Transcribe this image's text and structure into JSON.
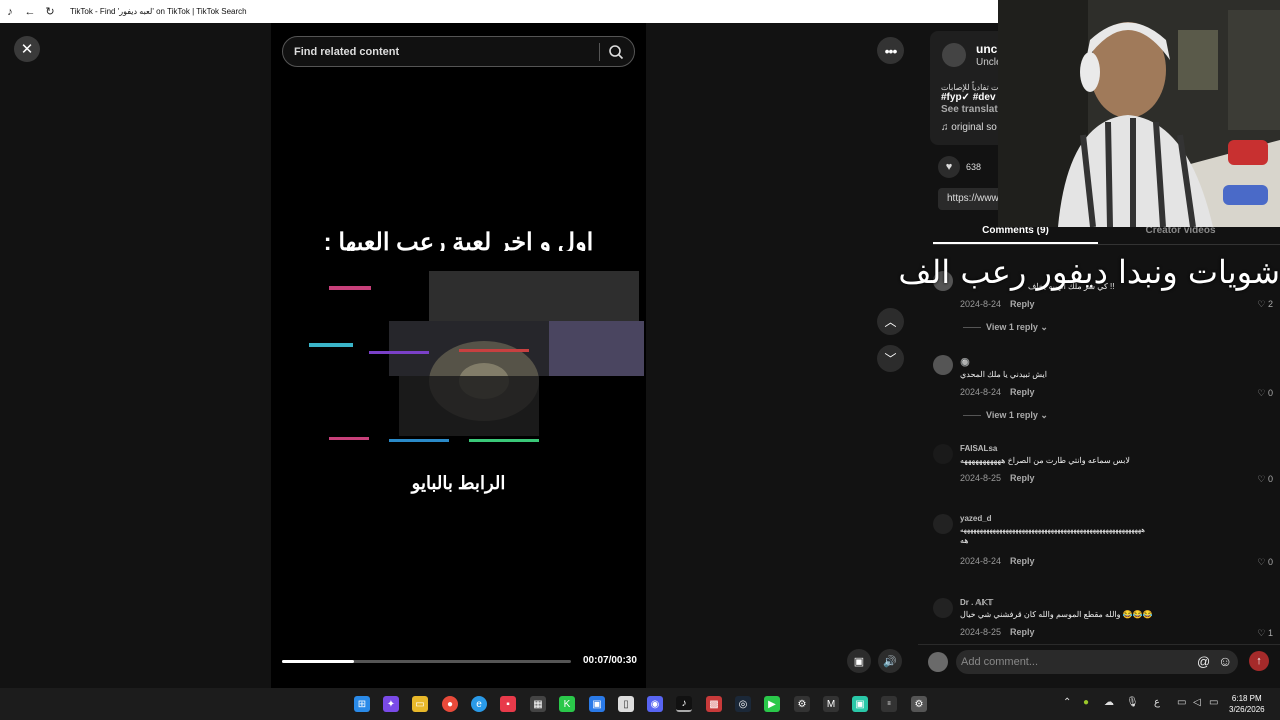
{
  "browser": {
    "title": "TikTok - Find 'لعبه ديفور' on TikTok | TikTok Search"
  },
  "search": {
    "placeholder": "Find related content"
  },
  "video": {
    "headline": "اول و اخر لعبة رعب العبها :",
    "link_text": "الرابط بالبايو",
    "time": "00:07/00:30",
    "progress": 0.25
  },
  "author": {
    "name": "uncl",
    "nickname": "Uncle",
    "description": "ت تفادياً للإصابات",
    "tags": "#fyp✓ #dev",
    "see_translation": "See translatio",
    "music": "original so",
    "likes": "638",
    "link": "https://www"
  },
  "tabs": {
    "comments": "Comments (9)",
    "creator": "Creator videos"
  },
  "caption_overlay": "شويات ونبدا ديفور رعب الف",
  "comments": [
    {
      "user": "",
      "text": "كي شر ملك الهيبه يخاف !!",
      "date": "2024-8-24",
      "reply": "Reply",
      "likes": "2",
      "view_reply": "View 1 reply"
    },
    {
      "user": "🔘",
      "text": "ايش تبيدني يا ملك المحدي",
      "date": "2024-8-24",
      "reply": "Reply",
      "likes": "0",
      "view_reply": "View 1 reply"
    },
    {
      "user": "FAISALsa",
      "text": "لابس سماعه وانتي طارت من الصراخ هههههههههههه",
      "date": "2024-8-25",
      "reply": "Reply",
      "likes": "0"
    },
    {
      "user": "yazed_d",
      "text": "ههههههههههههههههههههههههههههههههههههههههههههههههههههههههه",
      "text2": "هه",
      "date": "2024-8-24",
      "reply": "Reply",
      "likes": "0"
    },
    {
      "user": "Dr . 𝔸𝕂𝕋",
      "text": "والله مقطع الموسم والله كان قرفشني شي خيال 😂😂😂",
      "date": "2024-8-25",
      "reply": "Reply",
      "likes": "1"
    }
  ],
  "comment_bar": {
    "placeholder": "Add comment..."
  },
  "tray": {
    "lang": "ع",
    "time": "6:18 PM",
    "date": "3/26/2026"
  },
  "icons": {
    "close": "close-icon",
    "search": "search-icon",
    "more": "more-icon",
    "up": "chevron-up-icon",
    "down": "chevron-down-icon",
    "volume": "volume-icon"
  }
}
